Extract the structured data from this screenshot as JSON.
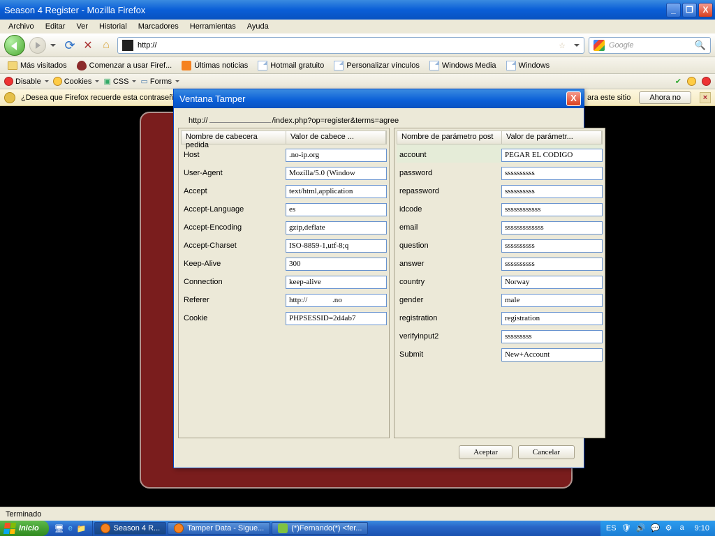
{
  "titlebar": {
    "title": "Season 4 Register - Mozilla Firefox"
  },
  "menu": {
    "archivo": "Archivo",
    "editar": "Editar",
    "ver": "Ver",
    "historial": "Historial",
    "marcadores": "Marcadores",
    "herramientas": "Herramientas",
    "ayuda": "Ayuda"
  },
  "url": {
    "prefix": "http://"
  },
  "search": {
    "placeholder": "Google"
  },
  "bookmarks": {
    "masvisitados": "Más visitados",
    "comenzar": "Comenzar a usar Firef...",
    "ultimas": "Últimas noticias",
    "hotmail": "Hotmail gratuito",
    "personalizar": "Personalizar vínculos",
    "wmedia": "Windows Media",
    "windows": "Windows"
  },
  "devbar": {
    "disable": "Disable",
    "cookies": "Cookies",
    "css": "CSS",
    "forms": "Forms"
  },
  "infobar": {
    "msg_left": "¿Desea que Firefox recuerde esta contraseñ",
    "msg_right": "ara este sitio",
    "ahora_no": "Ahora no"
  },
  "dialog": {
    "title": "Ventana Tamper",
    "url_p1": "http://",
    "url_p2": "/index.php?op=register&terms=agree",
    "left": {
      "col1": "Nombre de cabecera pedida",
      "col2": "Valor de cabece ...",
      "rows": [
        {
          "k": "Host",
          "v": ".no-ip.org"
        },
        {
          "k": "User-Agent",
          "v": "Mozilla/5.0 (Window"
        },
        {
          "k": "Accept",
          "v": "text/html,application"
        },
        {
          "k": "Accept-Language",
          "v": "es"
        },
        {
          "k": "Accept-Encoding",
          "v": "gzip,deflate"
        },
        {
          "k": "Accept-Charset",
          "v": "ISO-8859-1,utf-8;q"
        },
        {
          "k": "Keep-Alive",
          "v": "300"
        },
        {
          "k": "Connection",
          "v": "keep-alive"
        },
        {
          "k": "Referer",
          "v": "http://             .no"
        },
        {
          "k": "Cookie",
          "v": "PHPSESSID=2d4ab7"
        }
      ]
    },
    "right": {
      "col1": "Nombre de parámetro post",
      "col2": "Valor de parámetr...",
      "rows": [
        {
          "k": "account",
          "v": "PEGAR EL CODIGO"
        },
        {
          "k": "password",
          "v": "ssssssssss"
        },
        {
          "k": "repassword",
          "v": "ssssssssss"
        },
        {
          "k": "idcode",
          "v": "ssssssssssss"
        },
        {
          "k": "email",
          "v": "sssssssssssss"
        },
        {
          "k": "question",
          "v": "ssssssssss"
        },
        {
          "k": "answer",
          "v": "ssssssssss"
        },
        {
          "k": "country",
          "v": "Norway"
        },
        {
          "k": "gender",
          "v": "male"
        },
        {
          "k": "registration",
          "v": "registration"
        },
        {
          "k": "verifyinput2",
          "v": "sssssssss"
        },
        {
          "k": "Submit",
          "v": "New+Account"
        }
      ]
    },
    "aceptar": "Aceptar",
    "cancelar": "Cancelar"
  },
  "status": {
    "text": "Terminado"
  },
  "taskbar": {
    "start": "Inicio",
    "task1": "Season 4 R...",
    "task2": "Tamper Data - Sigue...",
    "task3": "(*)Fernando(*) <fer...",
    "lang": "ES",
    "time": "9:10"
  }
}
